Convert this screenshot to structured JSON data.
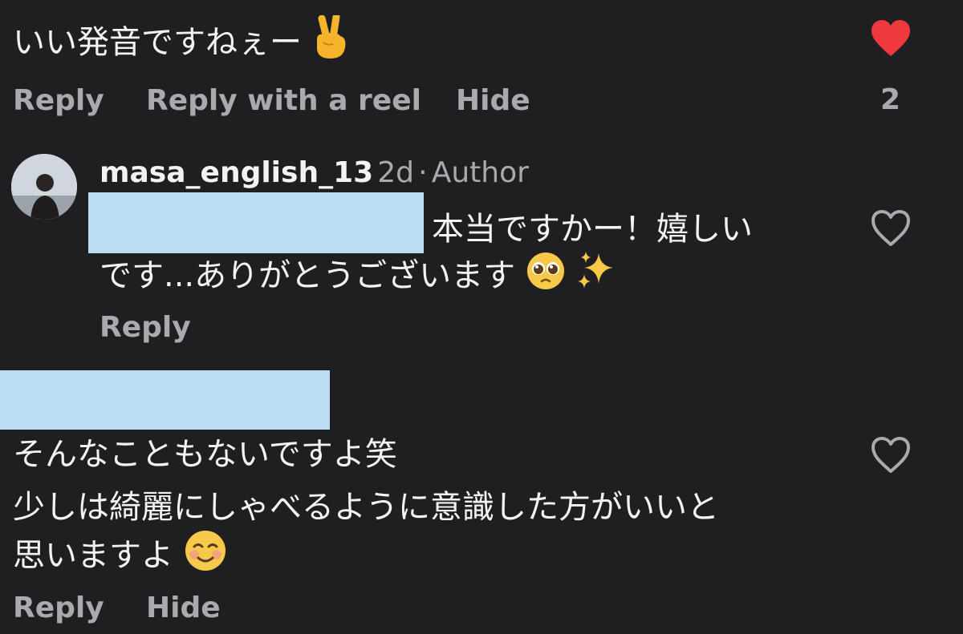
{
  "comments": [
    {
      "text": "いい発音ですねぇー",
      "emoji": "peace-hand",
      "liked": true,
      "like_count": "2",
      "actions": [
        "Reply",
        "Reply with a reel",
        "Hide"
      ]
    },
    {
      "username": "masa_english_13",
      "time": "2d",
      "separator": "·",
      "role": "Author",
      "line1": "本当ですかー！嬉しい",
      "line2": "です...ありがとうございます",
      "emojis": [
        "pleading-face",
        "sparkles"
      ],
      "liked": false,
      "actions": [
        "Reply"
      ]
    },
    {
      "line1": "そんなこともないですよ笑",
      "line2": "少しは綺麗にしゃべるように意識した方がいいと",
      "line3": "思いますよ",
      "emoji": "smiling-face",
      "liked": false,
      "actions": [
        "Reply",
        "Hide"
      ]
    }
  ],
  "colors": {
    "background": "#1f1f22",
    "text": "#f3f3f3",
    "muted": "#a9a9ae",
    "like_red": "#f0393f",
    "redaction": "#bcdcf4"
  }
}
